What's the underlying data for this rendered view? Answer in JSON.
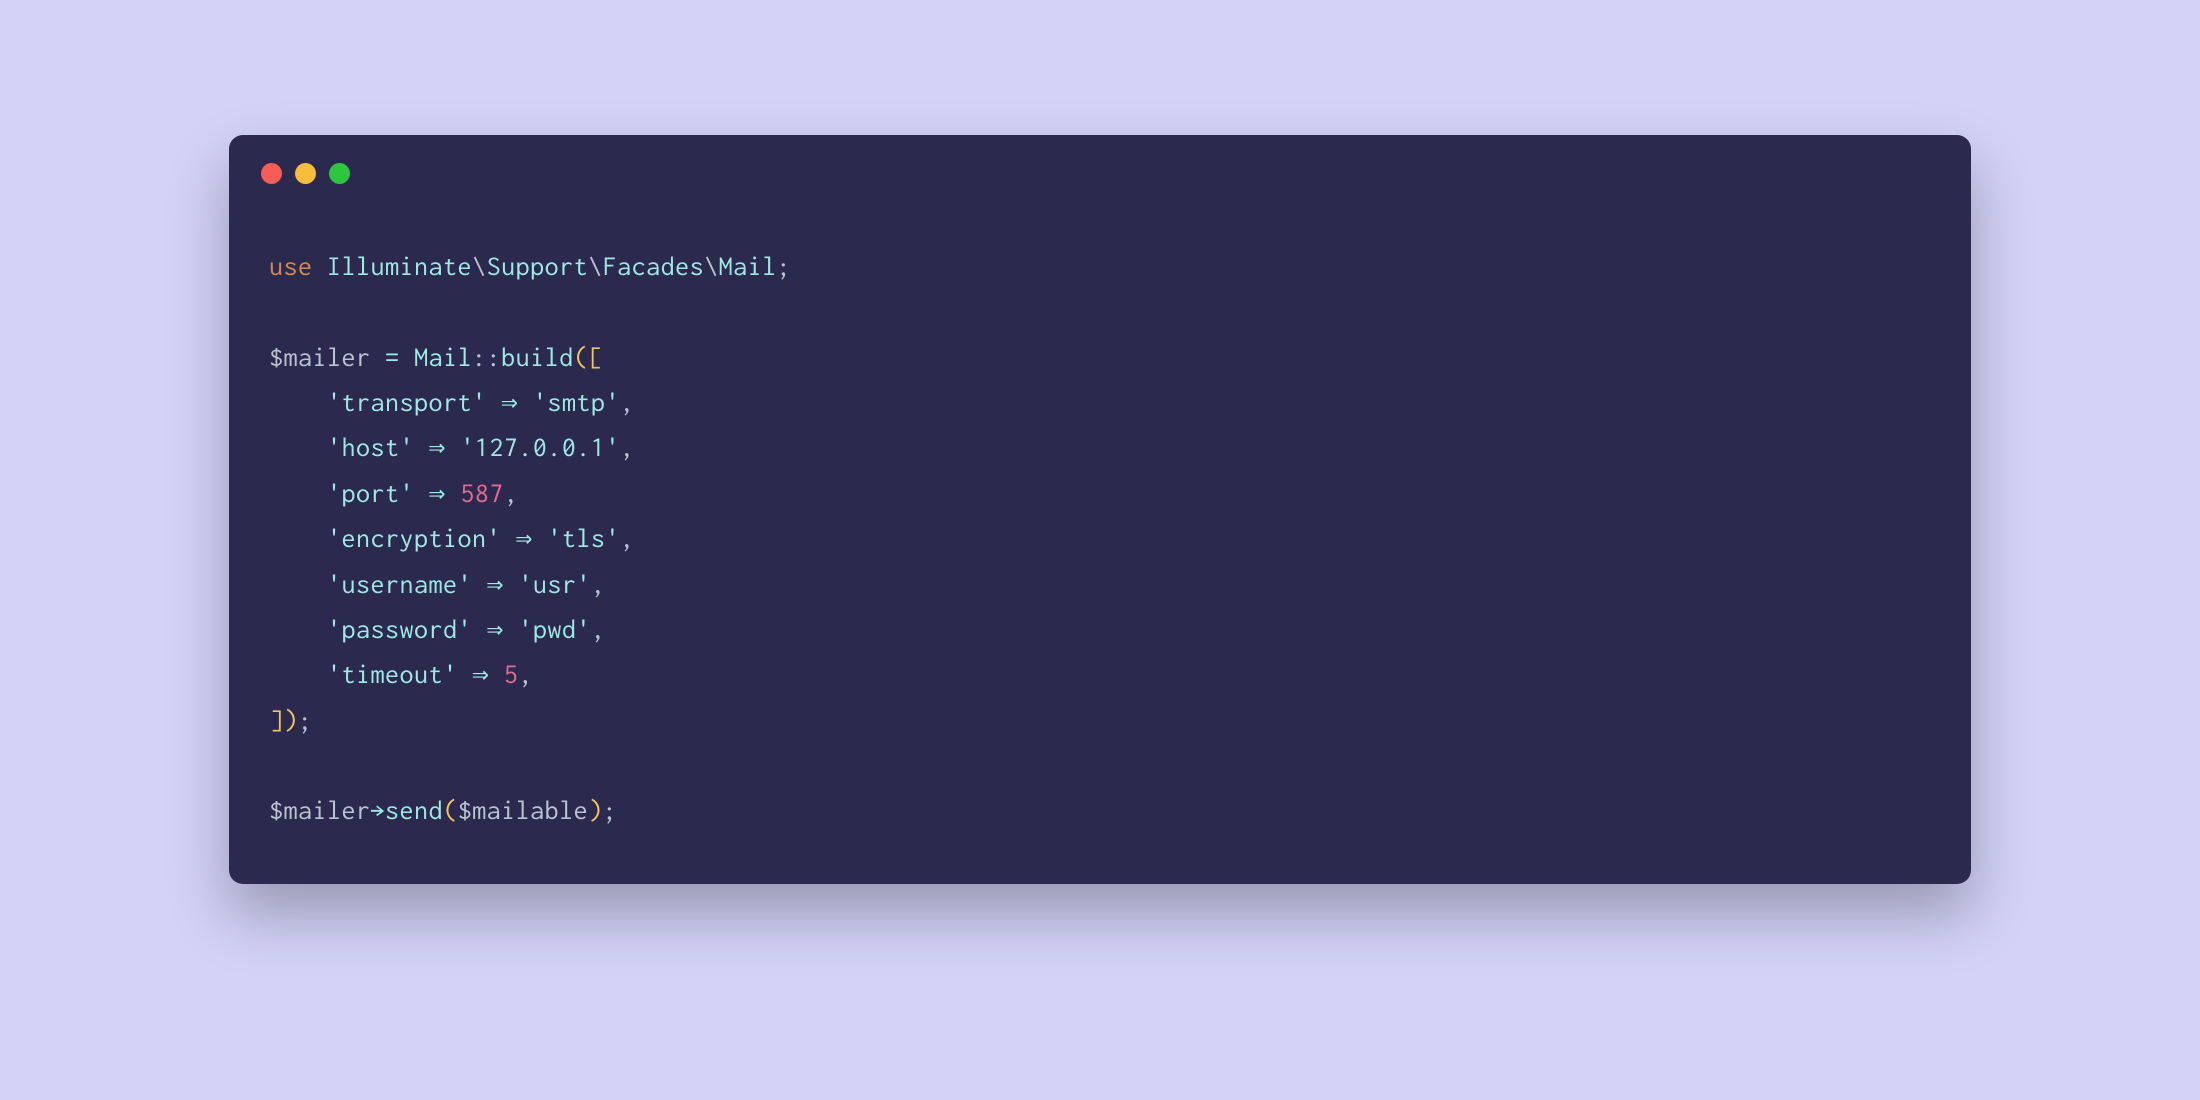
{
  "colors": {
    "background": "#d3d2f7",
    "terminal_bg": "#2b2a4e",
    "traffic_red": "#f55d56",
    "traffic_yellow": "#f7be3c",
    "traffic_green": "#2ec63f",
    "keyword": "#d8894e",
    "identifier": "#9fe9e5",
    "string": "#9fe9e5",
    "number": "#e06d90",
    "bracket": "#f2c55c",
    "default": "#b8c4d1"
  },
  "code": {
    "line1": {
      "use": "use",
      "sp1": " ",
      "ns1": "Illuminate",
      "bs1": "\\",
      "ns2": "Support",
      "bs2": "\\",
      "ns3": "Facades",
      "bs3": "\\",
      "ns4": "Mail",
      "semi": ";"
    },
    "blank1": "",
    "line3": {
      "var": "$mailer",
      "sp1": " ",
      "eq": "=",
      "sp2": " ",
      "cls": "Mail",
      "scope": "::",
      "method": "build",
      "open": "([",
      "close": ""
    },
    "line4": {
      "indent": "    ",
      "key": "'transport'",
      "sp1": " ",
      "arrow": "⇒",
      "sp2": " ",
      "val": "'smtp'",
      "comma": ","
    },
    "line5": {
      "indent": "    ",
      "key": "'host'",
      "sp1": " ",
      "arrow": "⇒",
      "sp2": " ",
      "val": "'127.0.0.1'",
      "comma": ","
    },
    "line6": {
      "indent": "    ",
      "key": "'port'",
      "sp1": " ",
      "arrow": "⇒",
      "sp2": " ",
      "val": "587",
      "comma": ","
    },
    "line7": {
      "indent": "    ",
      "key": "'encryption'",
      "sp1": " ",
      "arrow": "⇒",
      "sp2": " ",
      "val": "'tls'",
      "comma": ","
    },
    "line8": {
      "indent": "    ",
      "key": "'username'",
      "sp1": " ",
      "arrow": "⇒",
      "sp2": " ",
      "val": "'usr'",
      "comma": ","
    },
    "line9": {
      "indent": "    ",
      "key": "'password'",
      "sp1": " ",
      "arrow": "⇒",
      "sp2": " ",
      "val": "'pwd'",
      "comma": ","
    },
    "line10": {
      "indent": "    ",
      "key": "'timeout'",
      "sp1": " ",
      "arrow": "⇒",
      "sp2": " ",
      "val": "5",
      "comma": ","
    },
    "line11": {
      "close": "])",
      "semi": ";"
    },
    "blank2": "",
    "line13": {
      "var": "$mailer",
      "arrow": "→",
      "method": "send",
      "open": "(",
      "arg": "$mailable",
      "close": ")",
      "semi": ";"
    }
  }
}
